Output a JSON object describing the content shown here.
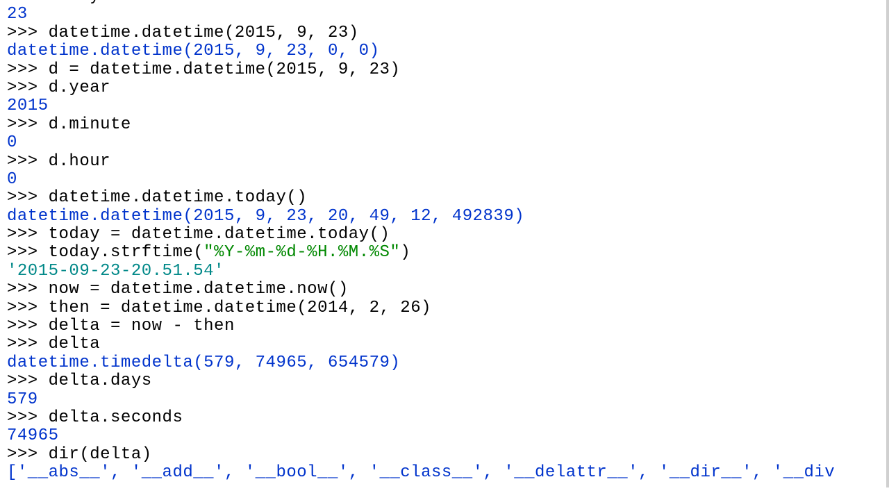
{
  "lines": [
    {
      "type": "input",
      "prompt": ">>> ",
      "text": "d.day",
      "cls": "partial-top"
    },
    {
      "type": "output",
      "text": "23",
      "color": "blue"
    },
    {
      "type": "input",
      "prompt": ">>> ",
      "text": "datetime.datetime(2015, 9, 23)"
    },
    {
      "type": "output",
      "text": "datetime.datetime(2015, 9, 23, 0, 0)",
      "color": "blue"
    },
    {
      "type": "input",
      "prompt": ">>> ",
      "text": "d = datetime.datetime(2015, 9, 23)"
    },
    {
      "type": "input",
      "prompt": ">>> ",
      "text": "d.year"
    },
    {
      "type": "output",
      "text": "2015",
      "color": "blue"
    },
    {
      "type": "input",
      "prompt": ">>> ",
      "text": "d.minute"
    },
    {
      "type": "output",
      "text": "0",
      "color": "blue"
    },
    {
      "type": "input",
      "prompt": ">>> ",
      "text": "d.hour"
    },
    {
      "type": "output",
      "text": "0",
      "color": "blue"
    },
    {
      "type": "input",
      "prompt": ">>> ",
      "text": "datetime.datetime.today()"
    },
    {
      "type": "output",
      "text": "datetime.datetime(2015, 9, 23, 20, 49, 12, 492839)",
      "color": "blue"
    },
    {
      "type": "input",
      "prompt": ">>> ",
      "text": "today = datetime.datetime.today()"
    },
    {
      "type": "input-strftime",
      "prompt": ">>> ",
      "before": "today.strftime(",
      "str": "\"%Y-%m-%d-%H.%M.%S\"",
      "after": ")"
    },
    {
      "type": "output",
      "text": "'2015-09-23-20.51.54'",
      "color": "teal"
    },
    {
      "type": "input",
      "prompt": ">>> ",
      "text": "now = datetime.datetime.now()"
    },
    {
      "type": "input",
      "prompt": ">>> ",
      "text": "then = datetime.datetime(2014, 2, 26)"
    },
    {
      "type": "input",
      "prompt": ">>> ",
      "text": "delta = now - then"
    },
    {
      "type": "input",
      "prompt": ">>> ",
      "text": "delta"
    },
    {
      "type": "output",
      "text": "datetime.timedelta(579, 74965, 654579)",
      "color": "blue"
    },
    {
      "type": "input",
      "prompt": ">>> ",
      "text": "delta.days"
    },
    {
      "type": "output",
      "text": "579",
      "color": "blue"
    },
    {
      "type": "input",
      "prompt": ">>> ",
      "text": "delta.seconds"
    },
    {
      "type": "output",
      "text": "74965",
      "color": "blue"
    },
    {
      "type": "input",
      "prompt": ">>> ",
      "text": "dir(delta)"
    },
    {
      "type": "output",
      "text": "['__abs__', '__add__', '__bool__', '__class__', '__delattr__', '__dir__', '__div",
      "color": "blue"
    }
  ]
}
